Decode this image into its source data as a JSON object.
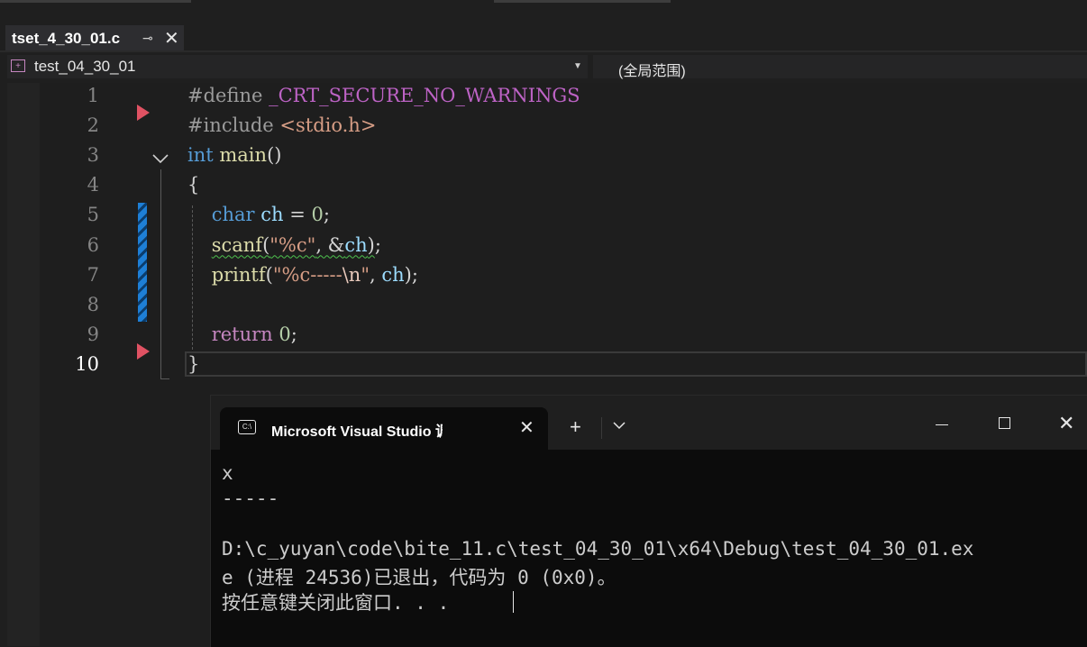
{
  "tab": {
    "title": "tset_4_30_01.c",
    "pin": "⊸",
    "close": "✕"
  },
  "nav": {
    "project": "test_04_30_01",
    "scope": "(全局范围)"
  },
  "editor": {
    "line_numbers": [
      "1",
      "2",
      "3",
      "4",
      "5",
      "6",
      "7",
      "8",
      "9",
      "10"
    ],
    "lines": [
      [
        {
          "t": "#define ",
          "c": "pp"
        },
        {
          "t": "_CRT_SECURE_NO_WARNINGS",
          "c": "macro"
        }
      ],
      [
        {
          "t": "#include ",
          "c": "pp"
        },
        {
          "t": "<stdio.h>",
          "c": "str"
        }
      ],
      [
        {
          "t": "int",
          "c": "kw"
        },
        {
          "t": " "
        },
        {
          "t": "main",
          "c": "fn"
        },
        {
          "t": "()"
        }
      ],
      [
        {
          "t": "{"
        }
      ],
      [
        {
          "t": "    "
        },
        {
          "t": "char",
          "c": "kw"
        },
        {
          "t": " "
        },
        {
          "t": "ch",
          "c": "var"
        },
        {
          "t": " = "
        },
        {
          "t": "0",
          "c": "num"
        },
        {
          "t": ";"
        }
      ],
      [
        {
          "t": "    "
        },
        {
          "t": "scanf(\"%c\", &ch)",
          "c": "mix-scanf"
        },
        {
          "t": ";"
        }
      ],
      [
        {
          "t": "    "
        },
        {
          "t": "printf",
          "c": "fn"
        },
        {
          "t": "("
        },
        {
          "t": "\"%c-----",
          "c": "str"
        },
        {
          "t": "\\n",
          "c": "esc"
        },
        {
          "t": "\"",
          "c": "str"
        },
        {
          "t": ", "
        },
        {
          "t": "ch",
          "c": "var"
        },
        {
          "t": ");"
        }
      ],
      [
        {
          "t": ""
        }
      ],
      [
        {
          "t": "    "
        },
        {
          "t": "return",
          "c": "kw2"
        },
        {
          "t": " "
        },
        {
          "t": "0",
          "c": "num"
        },
        {
          "t": ";"
        }
      ],
      [
        {
          "t": "}"
        }
      ]
    ]
  },
  "terminal": {
    "title": "Microsoft Visual Studio 调试控制台",
    "icon": "C:\\",
    "output": [
      "x",
      "-----",
      "",
      "D:\\c_yuyan\\code\\bite_11.c\\test_04_30_01\\x64\\Debug\\test_04_30_01.ex",
      "e (进程 24536)已退出，代码为 0 (0x0)。",
      "按任意键关闭此窗口. . ."
    ]
  },
  "colors": {
    "keyword": "#569cd6",
    "function": "#dcdcaa",
    "string": "#d69d85",
    "breakpoint": "#e05263",
    "changebar": "#1e7fd6"
  }
}
